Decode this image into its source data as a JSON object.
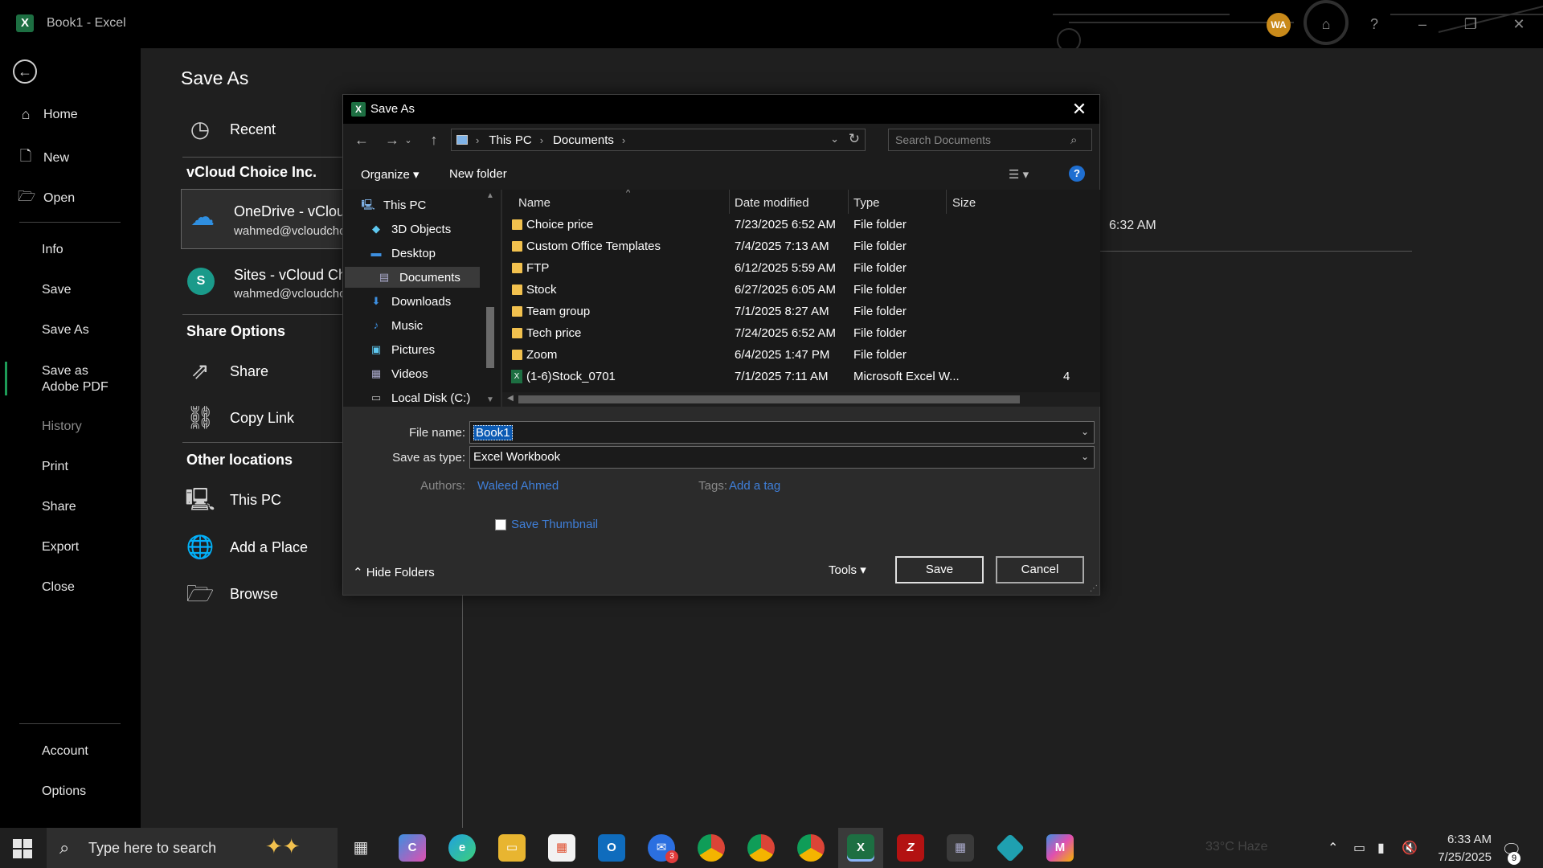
{
  "window": {
    "title": "Book1  -  Excel",
    "avatar_initials": "WA",
    "help_glyph": "?"
  },
  "leftnav": {
    "items": [
      {
        "label": "Home",
        "icon": "home-icon"
      },
      {
        "label": "New",
        "icon": "new-document-icon"
      },
      {
        "label": "Open",
        "icon": "open-folder-icon"
      },
      {
        "label": "Info"
      },
      {
        "label": "Save"
      },
      {
        "label": "Save As",
        "active": true
      },
      {
        "label": "Save as Adobe PDF"
      },
      {
        "label": "History",
        "disabled": true
      },
      {
        "label": "Print"
      },
      {
        "label": "Share"
      },
      {
        "label": "Export"
      },
      {
        "label": "Close"
      },
      {
        "label": "Account"
      },
      {
        "label": "Options"
      }
    ]
  },
  "saveas": {
    "title": "Save As",
    "recent": "Recent",
    "org_heading": "vCloud Choice Inc.",
    "onedrive_title": "OneDrive - vCloud Choice Inc.",
    "onedrive_email": "wahmed@vcloudchoice.com",
    "sites_title": "Sites - vCloud Choice Inc.",
    "sites_email": "wahmed@vcloudchoice.com",
    "share_heading": "Share Options",
    "share": "Share",
    "copy_link": "Copy Link",
    "other_heading": "Other locations",
    "this_pc": "This PC",
    "add_place": "Add a Place",
    "browse": "Browse",
    "right_time": "6:32 AM"
  },
  "dialog": {
    "title": "Save As",
    "breadcrumb": [
      "This PC",
      "Documents"
    ],
    "search_placeholder": "Search Documents",
    "organize": "Organize",
    "new_folder": "New folder",
    "tree": [
      {
        "label": "This PC",
        "icon": "pc-icon"
      },
      {
        "label": "3D Objects",
        "icon": "3d-objects-icon"
      },
      {
        "label": "Desktop",
        "icon": "desktop-icon"
      },
      {
        "label": "Documents",
        "icon": "documents-icon",
        "selected": true
      },
      {
        "label": "Downloads",
        "icon": "downloads-icon"
      },
      {
        "label": "Music",
        "icon": "music-icon"
      },
      {
        "label": "Pictures",
        "icon": "pictures-icon"
      },
      {
        "label": "Videos",
        "icon": "videos-icon"
      },
      {
        "label": "Local Disk (C:)",
        "icon": "disk-icon"
      }
    ],
    "columns": [
      "Name",
      "Date modified",
      "Type",
      "Size"
    ],
    "files": [
      {
        "name": "Choice price",
        "date": "7/23/2025 6:52 AM",
        "type": "File folder",
        "size": "",
        "kind": "folder"
      },
      {
        "name": "Custom Office Templates",
        "date": "7/4/2025 7:13 AM",
        "type": "File folder",
        "size": "",
        "kind": "folder"
      },
      {
        "name": "FTP",
        "date": "6/12/2025 5:59 AM",
        "type": "File folder",
        "size": "",
        "kind": "folder"
      },
      {
        "name": "Stock",
        "date": "6/27/2025 6:05 AM",
        "type": "File folder",
        "size": "",
        "kind": "folder"
      },
      {
        "name": "Team group",
        "date": "7/1/2025 8:27 AM",
        "type": "File folder",
        "size": "",
        "kind": "folder"
      },
      {
        "name": "Tech price",
        "date": "7/24/2025 6:52 AM",
        "type": "File folder",
        "size": "",
        "kind": "folder"
      },
      {
        "name": "Zoom",
        "date": "6/4/2025 1:47 PM",
        "type": "File folder",
        "size": "",
        "kind": "folder"
      },
      {
        "name": "(1-6)Stock_0701",
        "date": "7/1/2025 7:11 AM",
        "type": "Microsoft Excel W...",
        "size": "4",
        "kind": "excel"
      }
    ],
    "file_name_label": "File name:",
    "file_name_value": "Book1",
    "save_type_label": "Save as type:",
    "save_type_value": "Excel Workbook",
    "authors_label": "Authors:",
    "authors_value": "Waleed Ahmed",
    "tags_label": "Tags:",
    "tags_value": "Add a tag",
    "thumbnail_label": "Save Thumbnail",
    "hide_folders": "Hide Folders",
    "tools": "Tools",
    "save": "Save",
    "cancel": "Cancel"
  },
  "taskbar": {
    "search_placeholder": "Type here to search",
    "weather": "33°C  Haze",
    "time": "6:33 AM",
    "date": "7/25/2025",
    "notifications": "9",
    "mail_badge": "3",
    "apps": [
      "task-view",
      "copilot",
      "edge",
      "file-explorer",
      "microsoft-store",
      "outlook",
      "zoho",
      "chrome",
      "chrome",
      "chrome",
      "excel",
      "filezilla",
      "calculator",
      "app",
      "microsoft-365"
    ]
  },
  "colors": {
    "excel_green": "#1d6f42",
    "accent_link": "#3f7fd9",
    "selection": "#0b5ab3",
    "active_nav": "#1d9b57"
  }
}
